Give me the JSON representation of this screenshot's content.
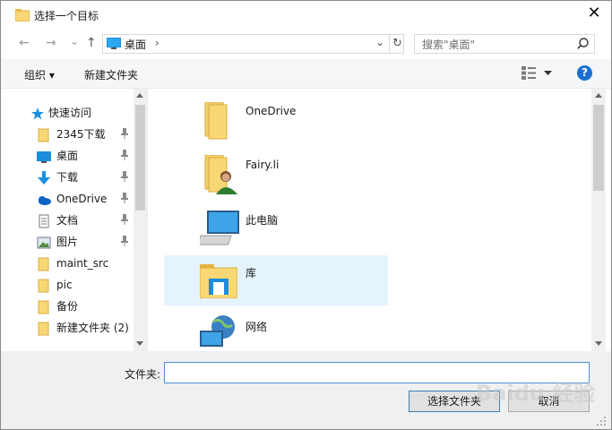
{
  "window": {
    "title": "选择一个目标",
    "close_glyph": "✕"
  },
  "address_bar": {
    "back_glyph": "←",
    "forward_glyph": "→",
    "up_glyph": "↑",
    "location": "桌面",
    "separator": "›",
    "dropdown_glyph": "⌄",
    "refresh_glyph": "↻"
  },
  "search": {
    "placeholder": "搜索\"桌面\"",
    "icon": "search-icon"
  },
  "toolbar": {
    "organize_label": "组织 ▾",
    "new_folder_label": "新建文件夹",
    "help_glyph": "?"
  },
  "nav_pane": {
    "quick_access_label": "快速访问",
    "items": [
      {
        "label": "2345下载",
        "icon": "folder-icon",
        "pinned": true
      },
      {
        "label": "桌面",
        "icon": "desktop-icon",
        "pinned": true
      },
      {
        "label": "下载",
        "icon": "download-icon",
        "pinned": true
      },
      {
        "label": "OneDrive",
        "icon": "cloud-icon",
        "pinned": true
      },
      {
        "label": "文档",
        "icon": "document-icon",
        "pinned": true
      },
      {
        "label": "图片",
        "icon": "picture-icon",
        "pinned": true
      },
      {
        "label": "maint_src",
        "icon": "folder-icon",
        "pinned": false
      },
      {
        "label": "pic",
        "icon": "folder-icon",
        "pinned": false
      },
      {
        "label": "备份",
        "icon": "folder-icon",
        "pinned": false
      },
      {
        "label": "新建文件夹 (2)",
        "icon": "folder-icon",
        "pinned": false
      }
    ]
  },
  "content": {
    "items": [
      {
        "label": "OneDrive",
        "icon": "folder-icon",
        "selected": false
      },
      {
        "label": "Fairy.li",
        "icon": "user-folder-icon",
        "selected": false
      },
      {
        "label": "此电脑",
        "icon": "computer-icon",
        "selected": false
      },
      {
        "label": "库",
        "icon": "library-icon",
        "selected": true
      },
      {
        "label": "网络",
        "icon": "network-icon",
        "selected": false
      }
    ]
  },
  "bottom": {
    "folder_label": "文件夹:",
    "folder_value": "",
    "select_button": "选择文件夹",
    "cancel_button": "取消"
  },
  "watermark": "Baidu 经验",
  "colors": {
    "selection": "#e5f3fd",
    "accent": "#0078d7",
    "folder": "#f8d775"
  }
}
